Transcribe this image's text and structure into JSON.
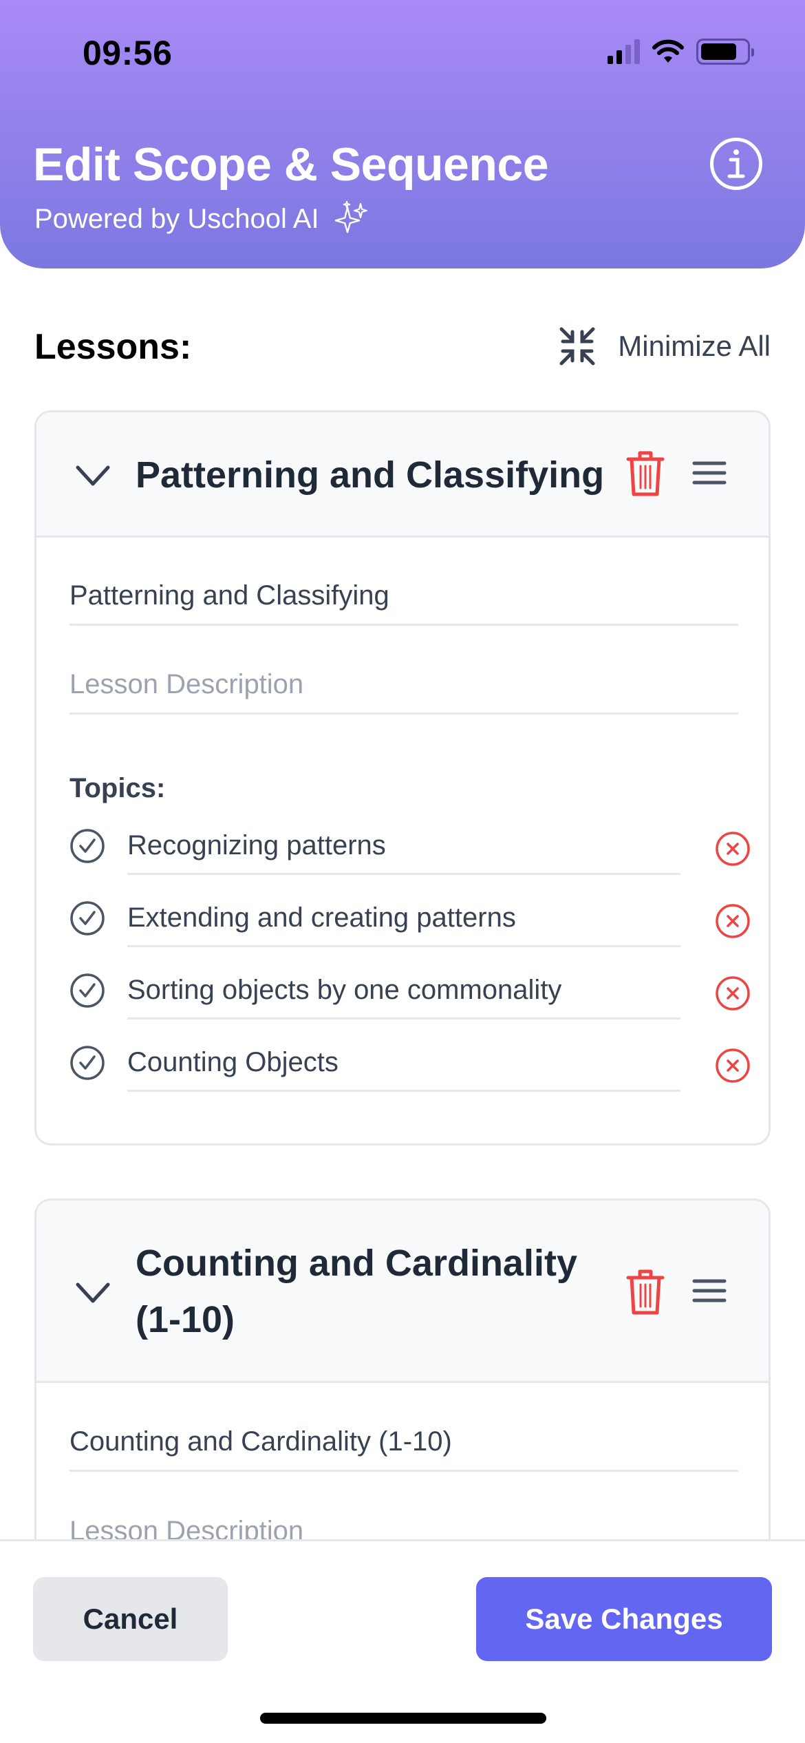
{
  "status_bar": {
    "time": "09:56"
  },
  "header": {
    "title": "Edit Scope & Sequence",
    "subtitle": "Powered by Uschool AI",
    "info_icon": "info-icon",
    "sparkle_icon": "sparkles-icon",
    "gradient_top": "#a98af6",
    "gradient_bottom": "#7b78e0"
  },
  "lessons_section": {
    "label": "Lessons:",
    "minimize_all_label": "Minimize All"
  },
  "lessons": [
    {
      "title": "Patterning and Classifying",
      "name_value": "Patterning and Classifying",
      "description_placeholder": "Lesson Description",
      "topics_label": "Topics:",
      "topics": [
        "Recognizing patterns",
        "Extending and creating patterns",
        "Sorting objects by one commonality",
        "Counting Objects"
      ]
    },
    {
      "title": "Counting and Cardinality (1-10)",
      "name_value": "Counting and Cardinality (1-10)",
      "description_placeholder": "Lesson Description"
    }
  ],
  "footer": {
    "cancel_label": "Cancel",
    "save_label": "Save Changes"
  },
  "colors": {
    "accent": "#6366f1",
    "danger": "#ef4444",
    "text_dark": "#1f2937",
    "border": "#e5e7eb"
  }
}
